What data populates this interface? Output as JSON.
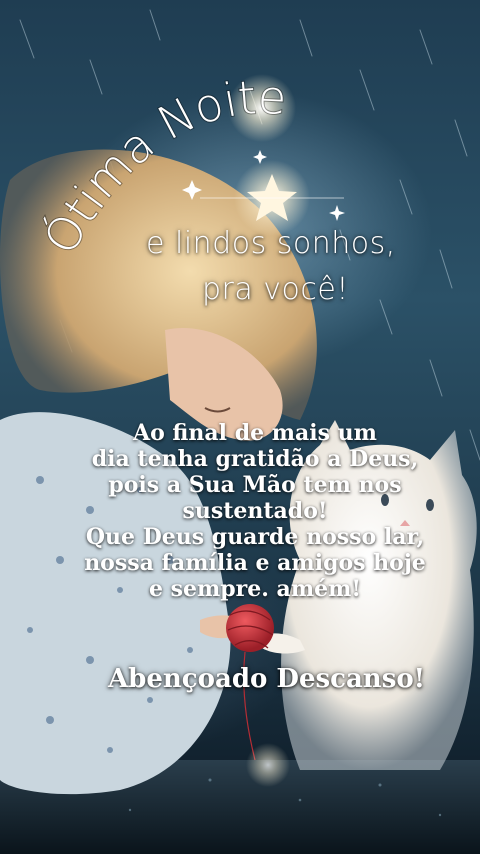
{
  "greeting": {
    "title": "Ótima Noite",
    "subtitle_line1": "e lindos sonhos,",
    "subtitle_line2": "pra você!"
  },
  "message": {
    "lines": [
      "Ao final de mais um",
      "dia tenha gratidão a Deus,",
      "pois a Sua Mão tem nos",
      "sustentado!",
      "Que Deus guarde nosso lar,",
      "nossa família e amigos hoje",
      "e sempre. amém!"
    ]
  },
  "closing": "Abençoado Descanso!",
  "colors": {
    "text": "#ffffff",
    "sky": "#2b5167",
    "yarn": "#c8343c",
    "kitten": "#f1ede6",
    "hair": "#d9b98a"
  },
  "icons": [
    "sparkle-star-icon",
    "yarn-ball-icon"
  ]
}
